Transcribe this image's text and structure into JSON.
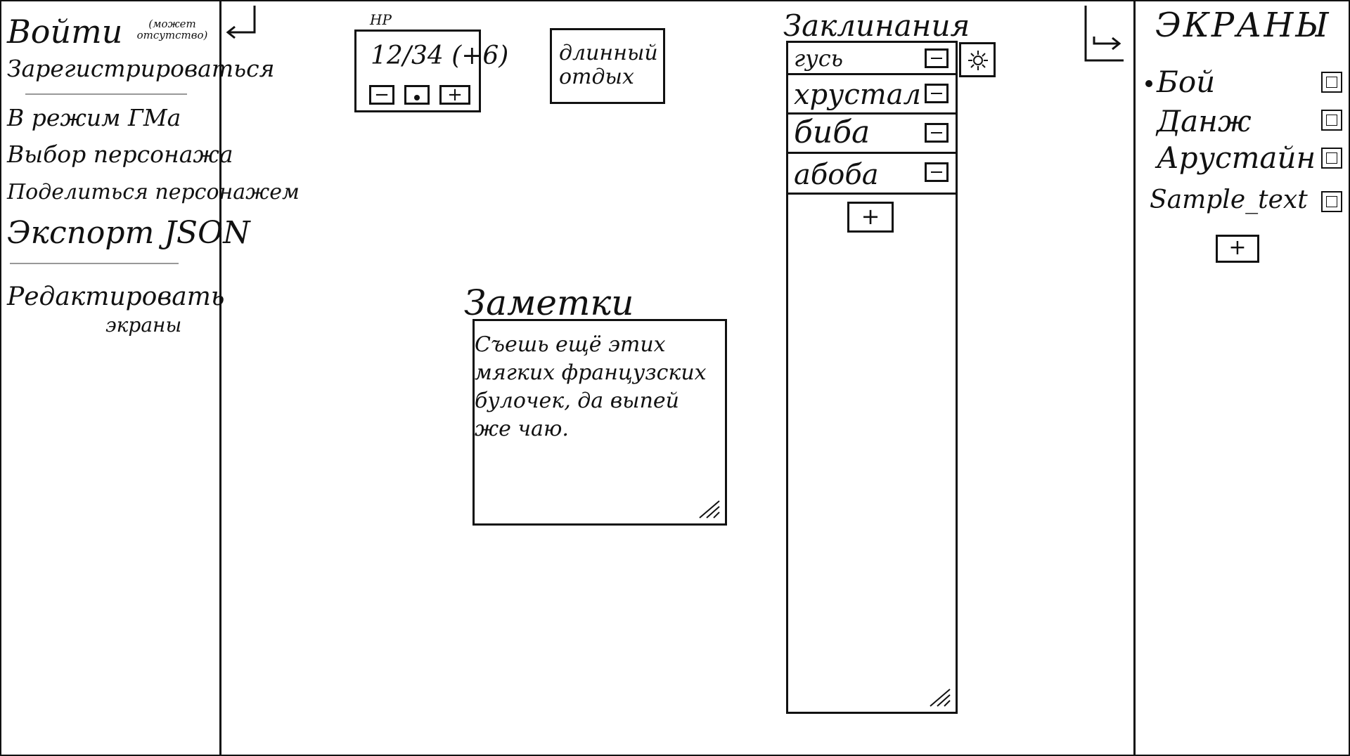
{
  "left_menu": {
    "login": "Войти",
    "login_note": "(может отсутство)",
    "register": "Зарегистрироваться",
    "gm_mode": "В режим ГМа",
    "choose_character": "Выбор персонажа",
    "share_character": "Поделиться персонажем",
    "export_json": "Экспорт JSON",
    "edit_screens": "Редактировать",
    "edit_screens_2": "экраны"
  },
  "hp": {
    "label": "HP",
    "value": "12/34 (+6)",
    "minus": "−",
    "plus": "+"
  },
  "long_rest": {
    "label": "длинный отдых"
  },
  "notes": {
    "title": "Заметки",
    "text": "Съешь ещё этих мягких французских булочек, да выпей же чаю."
  },
  "spells": {
    "title": "Заклинания",
    "items": [
      {
        "label": "гусь"
      },
      {
        "label": "хрустал"
      },
      {
        "label": "биба"
      },
      {
        "label": "абоба"
      }
    ],
    "add": "+"
  },
  "screens": {
    "title": "ЭКРАНЫ",
    "items": [
      {
        "label": "Бой"
      },
      {
        "label": "Данж"
      },
      {
        "label": "Арустайн"
      },
      {
        "label": "Sample_text"
      }
    ],
    "add": "+"
  }
}
